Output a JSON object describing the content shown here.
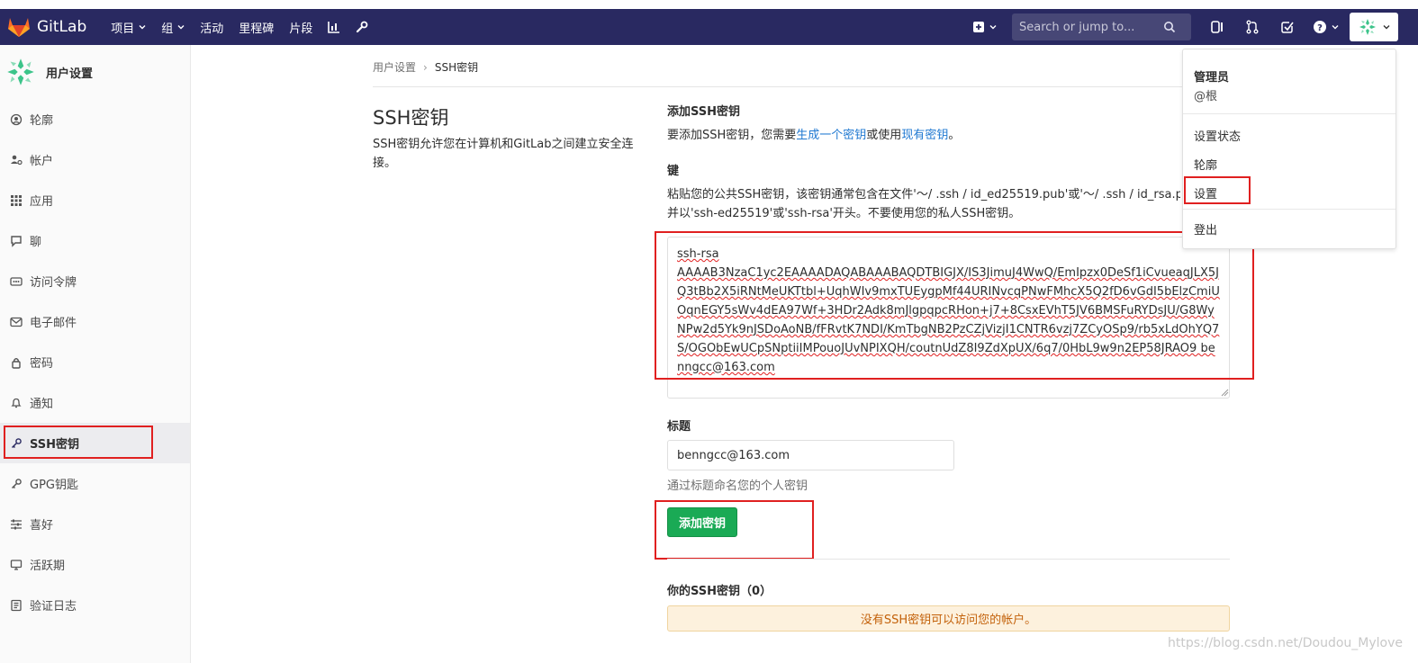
{
  "app": {
    "name": "GitLab",
    "colors": {
      "navbar": "#292961",
      "accent_green": "#1aaa55",
      "link_blue": "#1f78d1",
      "highlight_red": "#e02020",
      "warning_bg": "#fdf1dd",
      "warning_text": "#c3610a"
    }
  },
  "navbar": {
    "links": [
      {
        "label": "项目",
        "has_caret": true
      },
      {
        "label": "组",
        "has_caret": true
      },
      {
        "label": "活动"
      },
      {
        "label": "里程碑"
      },
      {
        "label": "片段"
      }
    ],
    "icons": [
      "chart-icon",
      "wrench-icon"
    ],
    "search_placeholder": "Search or jump to...",
    "right_icons": [
      "plus-square-icon",
      "sidebar-icon",
      "merge-request-icon",
      "todo-check-icon",
      "help-icon"
    ]
  },
  "sidebar": {
    "title": "用户设置",
    "items": [
      {
        "label": "轮廓",
        "icon": "profile-icon"
      },
      {
        "label": "帐户",
        "icon": "account-icon"
      },
      {
        "label": "应用",
        "icon": "applications-icon"
      },
      {
        "label": "聊",
        "icon": "chat-icon"
      },
      {
        "label": "访问令牌",
        "icon": "token-icon"
      },
      {
        "label": "电子邮件",
        "icon": "email-icon"
      },
      {
        "label": "密码",
        "icon": "lock-icon"
      },
      {
        "label": "通知",
        "icon": "bell-icon"
      },
      {
        "label": "SSH密钥",
        "icon": "key-icon",
        "active": true
      },
      {
        "label": "GPG钥匙",
        "icon": "key-icon"
      },
      {
        "label": "喜好",
        "icon": "preferences-icon"
      },
      {
        "label": "活跃期",
        "icon": "monitor-icon"
      },
      {
        "label": "验证日志",
        "icon": "log-icon"
      }
    ]
  },
  "breadcrumb": {
    "parent": "用户设置",
    "current": "SSH密钥"
  },
  "intro": {
    "title": "SSH密钥",
    "description": "SSH密钥允许您在计算机和GitLab之间建立安全连接。"
  },
  "add_key": {
    "section_title": "添加SSH密钥",
    "help_prefix": "要添加SSH密钥，您需要",
    "help_link1": "生成一个密钥",
    "help_middle": "或使用",
    "help_link2": "现有密钥",
    "help_suffix": "。",
    "key_label": "键",
    "key_help_line1": "粘贴您的公共SSH密钥，该密钥通常包含在文件'〜/ .ssh / id_ed25519.pub'或'〜/ .ssh / id_rsa.p",
    "key_help_line2": "并以'ssh-ed25519'或'ssh-rsa'开头。不要使用您的私人SSH密钥。",
    "key_value": "ssh-rsa\nAAAAB3NzaC1yc2EAAAADAQABAAABAQDTBIGJX/IS3JimuJ4WwQ/EmIpzx0DeSf1iCvueaqJLX5JQ3tBb2X5iRNtMeUKTtbl+UqhWIv9mxTUEygpMf44URINvcqPNwFMhcX5Q2fD6vGdI5bElzCmiUOqnEGY5sWv4dEA97Wf+3HDr2Adk8mJlgpqpcRHon+j7+8CsxEVhT5JV6BMSFuRYDsJU/G8WyNPw2d5Yk9nJSDoAoNB/fFRvtK7NDI/KmTbgNB2PzCZjVizjI1CNTR6vzj7ZCyOSp9/rb5xLdOhYQ7S/OGObEwUCpSNptiiIMPouoJUvNPIXQH/coutnUdZ8I9ZdXpUX/6q7/0HbL9w9n2EP58JRAO9 benngcc@163.com",
    "title_label": "标题",
    "title_value": "benngcc@163.com",
    "title_hint": "通过标题命名您的个人密钥",
    "submit_label": "添加密钥"
  },
  "your_keys": {
    "title": "你的SSH密钥（0）",
    "empty_message": "没有SSH密钥可以访问您的帐户。"
  },
  "user_menu": {
    "name": "管理员",
    "handle": "@根",
    "items": [
      {
        "label": "设置状态"
      },
      {
        "label": "轮廓"
      },
      {
        "label": "设置"
      },
      {
        "label": "登出"
      }
    ]
  },
  "watermark": "https://blog.csdn.net/Doudou_Mylove"
}
